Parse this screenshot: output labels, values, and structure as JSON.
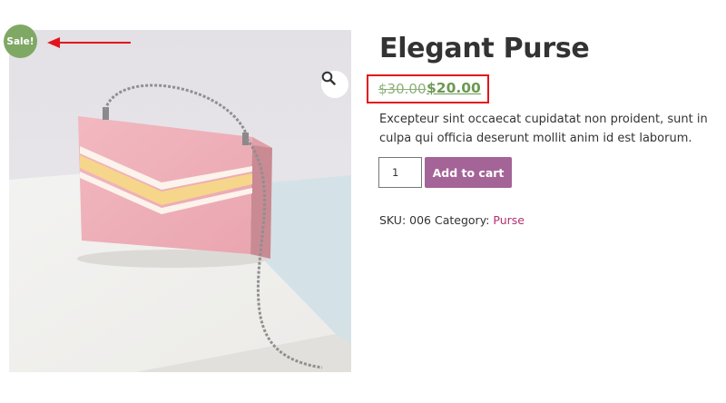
{
  "badge": {
    "label": "Sale!"
  },
  "product": {
    "title": "Elegant Purse",
    "regular_price": "$30.00",
    "sale_price": "$20.00",
    "description": "Excepteur sint occaecat cupidatat non proident, sunt in culpa qui officia deserunt mollit anim id est laborum.",
    "image_alt": "Pink purse with chain strap"
  },
  "cart": {
    "quantity": "1",
    "add_to_cart_label": "Add to cart"
  },
  "meta": {
    "sku_label": "SKU:",
    "sku_value": "006",
    "category_label": "Category:",
    "category_value": "Purse"
  },
  "gallery": {
    "zoom_icon": "magnifier-icon"
  },
  "annotation": {
    "arrow_icon": "arrow-left-icon",
    "highlight_color": "#e3141b"
  },
  "colors": {
    "sale_badge": "#7fa865",
    "sale_price": "#6b9a53",
    "button": "#a46497",
    "category_link": "#b3316f"
  }
}
